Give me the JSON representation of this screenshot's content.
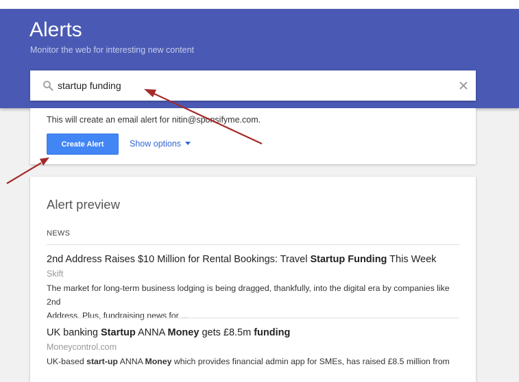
{
  "header": {
    "title": "Alerts",
    "subtitle": "Monitor the web for interesting new content"
  },
  "search": {
    "value": "startup funding",
    "search_icon": "search-icon",
    "clear_icon": "close-icon"
  },
  "create": {
    "info": "This will create an email alert for nitin@sponsifyme.com.",
    "create_label": "Create Alert",
    "options_label": "Show options"
  },
  "preview": {
    "title": "Alert preview",
    "section": "NEWS",
    "articles": [
      {
        "title_parts": [
          {
            "text": "2nd Address Raises $10 Million for Rental Bookings: Travel ",
            "bold": false
          },
          {
            "text": "Startup Funding",
            "bold": true
          },
          {
            "text": " This Week",
            "bold": false
          }
        ],
        "source": "Skift",
        "snippet_lines": [
          "The market for long-term business lodging is being dragged, thankfully, into the digital era by companies like 2nd",
          "Address. Plus, fundraising news for ..."
        ]
      },
      {
        "title_parts": [
          {
            "text": "UK banking ",
            "bold": false
          },
          {
            "text": "Startup",
            "bold": true
          },
          {
            "text": " ANNA ",
            "bold": false
          },
          {
            "text": "Money",
            "bold": true
          },
          {
            "text": " gets £8.5m ",
            "bold": false
          },
          {
            "text": "funding",
            "bold": true
          }
        ],
        "source": "Moneycontrol.com",
        "snippet_parts": [
          {
            "text": "UK-based ",
            "bold": false
          },
          {
            "text": "start-up",
            "bold": true
          },
          {
            "text": " ANNA ",
            "bold": false
          },
          {
            "text": "Money",
            "bold": true
          },
          {
            "text": " which provides financial admin app for SMEs, has raised £8.5 million from",
            "bold": false
          }
        ]
      }
    ]
  },
  "colors": {
    "header_bg": "#4a5ab4",
    "button_blue": "#4285f4",
    "link_blue": "#3367d6",
    "annotation_arrow": "#a52a2a"
  }
}
